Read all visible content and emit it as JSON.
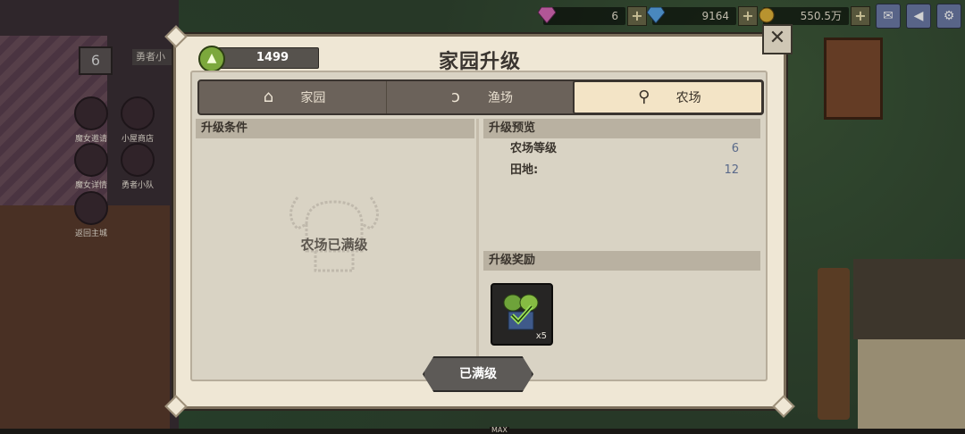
{
  "topbar": {
    "gems": "6",
    "diamonds": "9164",
    "gold": "550.5万",
    "plus": "+"
  },
  "left_menu": {
    "level": "6",
    "hero_tag": "勇者小",
    "buttons": [
      {
        "label": "魔女邀请"
      },
      {
        "label": "小屋商店"
      },
      {
        "label": "魔女详情"
      },
      {
        "label": "勇者小队"
      },
      {
        "label": "返回主城"
      }
    ]
  },
  "modal": {
    "level_value": "1499",
    "title": "家园升级",
    "close": "✕",
    "tabs": [
      {
        "label": "家园",
        "icon": "home-icon",
        "active": false
      },
      {
        "label": "渔场",
        "icon": "fishhook-icon",
        "active": false
      },
      {
        "label": "农场",
        "icon": "shovel-icon",
        "active": true
      }
    ],
    "conditions_title": "升级条件",
    "maxed_text": "农场已满级",
    "preview_title": "升级预览",
    "preview_rows": [
      {
        "label": "农场等级",
        "value": "6"
      },
      {
        "label": "田地:",
        "value": "12"
      }
    ],
    "reward_title": "升级奖励",
    "reward_item": {
      "icon": "sprout-icon",
      "count": "x5"
    },
    "action_button": "已满级"
  },
  "bottom_bar": {
    "label": "MAX"
  },
  "colors": {
    "modal_bg": "#efe7d5",
    "tab_active": "#f3e4c6",
    "section_head": "#b9b1a1",
    "level_arrow": "#7ca83c",
    "value_blue": "#5a6a8a"
  }
}
